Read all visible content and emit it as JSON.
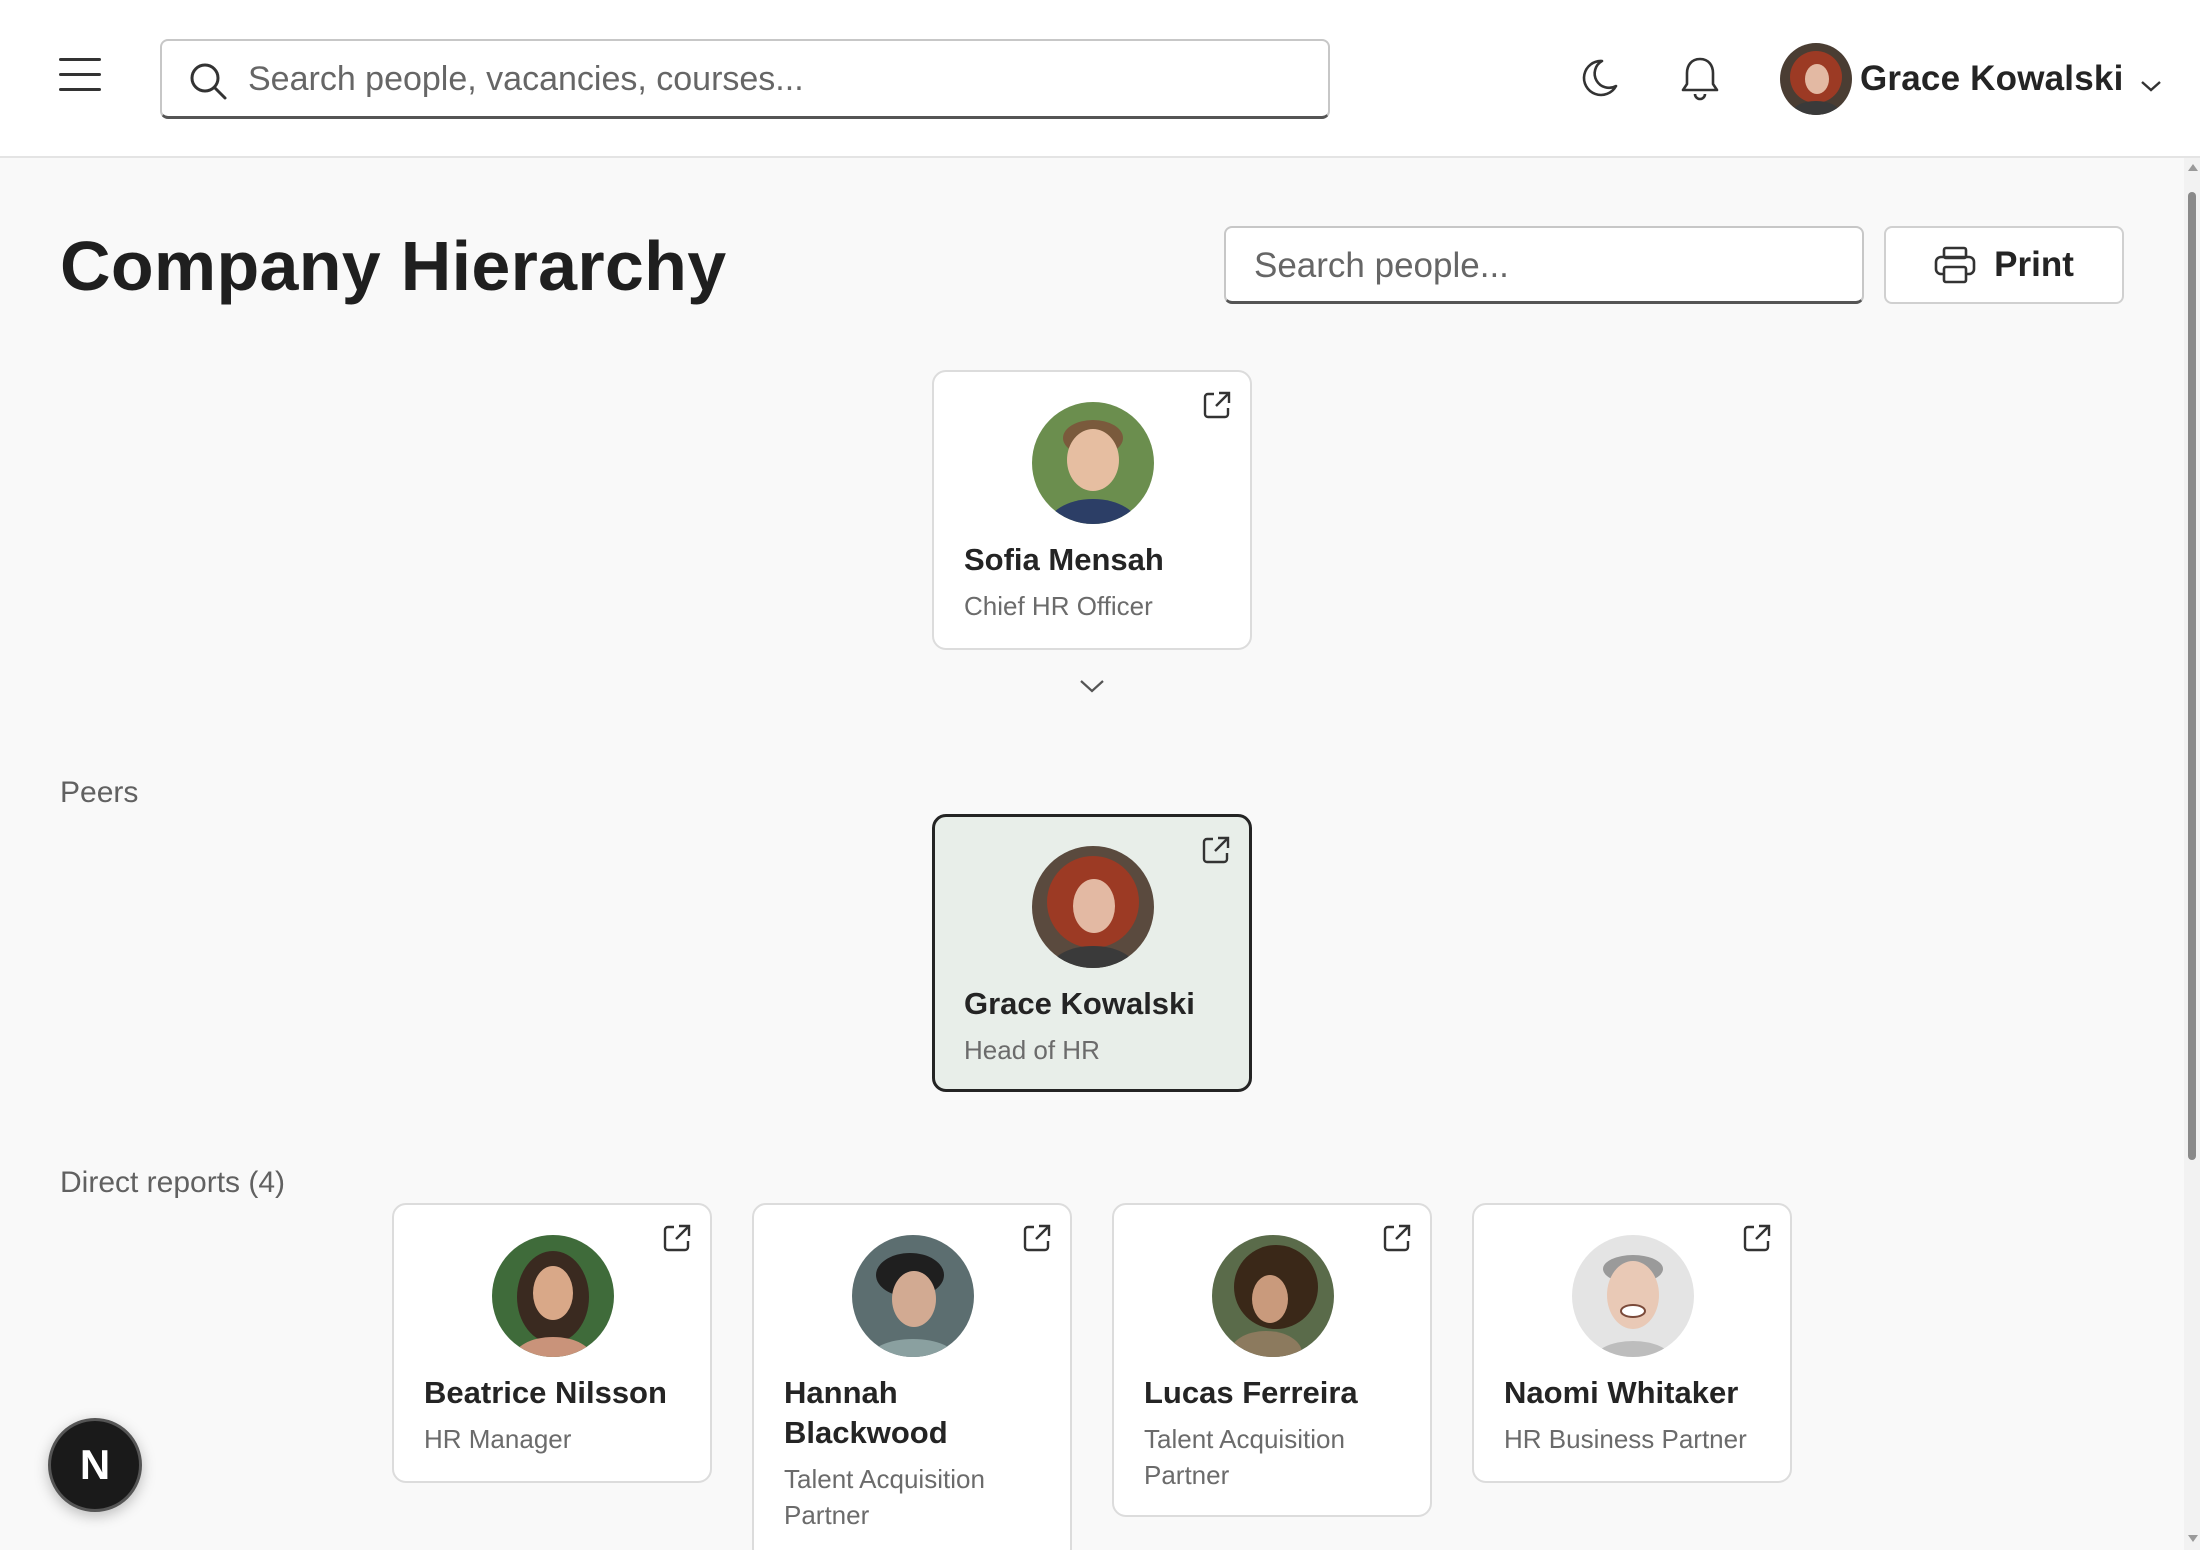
{
  "header": {
    "search": {
      "placeholder": "Search people, vacancies, courses..."
    },
    "user": {
      "name": "Grace Kowalski"
    },
    "icons": [
      "hamburger-menu-icon",
      "search-icon",
      "moon-icon",
      "bell-icon",
      "chevron-down-icon"
    ]
  },
  "page": {
    "title": "Company Hierarchy",
    "people_search": {
      "placeholder": "Search people..."
    },
    "print_label": "Print"
  },
  "manager": {
    "name": "Sofia Mensah",
    "role": "Chief HR Officer",
    "avatar_color": "#6b8e4e"
  },
  "peers": {
    "label": "Peers",
    "current": {
      "name": "Grace Kowalski",
      "role": "Head of HR",
      "avatar_color": "#8a3a2a"
    }
  },
  "direct_reports": {
    "label": "Direct reports (4)",
    "people": [
      {
        "name": "Beatrice Nilsson",
        "role": "HR Manager",
        "avatar_color": "#3f6b3a"
      },
      {
        "name": "Hannah Blackwood",
        "role": "Talent Acquisition Partner",
        "avatar_color": "#5c6e70"
      },
      {
        "name": "Lucas Ferreira",
        "role": "Talent Acquisition Partner",
        "avatar_color": "#4a3a2c"
      },
      {
        "name": "Naomi Whitaker",
        "role": "HR Business Partner",
        "avatar_color": "#cfcfcf"
      }
    ]
  },
  "badge": {
    "letter": "N"
  },
  "colors": {
    "accent_border": "#242424",
    "current_card_bg": "#e8eee9",
    "topbar_bg": "#ffffff"
  }
}
